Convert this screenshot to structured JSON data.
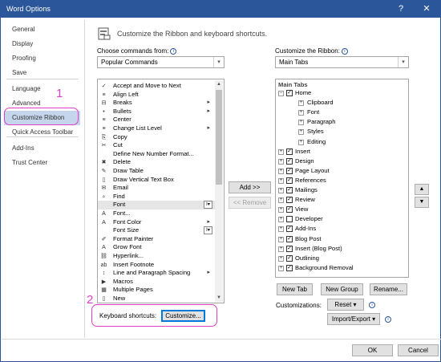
{
  "window": {
    "title": "Word Options",
    "help": "?",
    "close": "✕"
  },
  "nav": {
    "items": [
      {
        "label": "General"
      },
      {
        "label": "Display"
      },
      {
        "label": "Proofing"
      },
      {
        "label": "Save"
      },
      {
        "label": "Language"
      },
      {
        "label": "Advanced"
      },
      {
        "label": "Customize Ribbon"
      },
      {
        "label": "Quick Access Toolbar"
      },
      {
        "label": "Add-Ins"
      },
      {
        "label": "Trust Center"
      }
    ]
  },
  "header": {
    "text": "Customize the Ribbon and keyboard shortcuts."
  },
  "commands": {
    "label": "Choose commands from:",
    "selected": "Popular Commands",
    "items": [
      {
        "label": "Accept and Move to Next",
        "icon": "✓"
      },
      {
        "label": "Align Left",
        "icon": "≡"
      },
      {
        "label": "Breaks",
        "icon": "⊟",
        "sub": "▸"
      },
      {
        "label": "Bullets",
        "icon": "•",
        "sub": "▸"
      },
      {
        "label": "Center",
        "icon": "≡"
      },
      {
        "label": "Change List Level",
        "icon": "≡",
        "sub": "▸"
      },
      {
        "label": "Copy",
        "icon": "⎘"
      },
      {
        "label": "Cut",
        "icon": "✂"
      },
      {
        "label": "Define New Number Format...",
        "icon": ""
      },
      {
        "label": "Delete",
        "icon": "✖"
      },
      {
        "label": "Draw Table",
        "icon": "✎"
      },
      {
        "label": "Draw Vertical Text Box",
        "icon": "▯"
      },
      {
        "label": "Email",
        "icon": "✉"
      },
      {
        "label": "Find",
        "icon": "⌕"
      },
      {
        "label": "Font",
        "icon": "",
        "fbox": "I▾"
      },
      {
        "label": "Font...",
        "icon": "A"
      },
      {
        "label": "Font Color",
        "icon": "A",
        "sub": "▸"
      },
      {
        "label": "Font Size",
        "icon": "",
        "fbox": "I▾"
      },
      {
        "label": "Format Painter",
        "icon": "✐"
      },
      {
        "label": "Grow Font",
        "icon": "A"
      },
      {
        "label": "Hyperlink...",
        "icon": "⛓"
      },
      {
        "label": "Insert Footnote",
        "icon": "ab"
      },
      {
        "label": "Line and Paragraph Spacing",
        "icon": "↕",
        "sub": "▸"
      },
      {
        "label": "Macros",
        "icon": "▶"
      },
      {
        "label": "Multiple Pages",
        "icon": "▦"
      },
      {
        "label": "New",
        "icon": "▯"
      }
    ]
  },
  "middle": {
    "add": "Add >>",
    "remove": "<< Remove"
  },
  "ribbon": {
    "label": "Customize the Ribbon:",
    "selected": "Main Tabs",
    "header": "Main Tabs",
    "tree": [
      {
        "label": "Home",
        "level": 0,
        "exp": "−",
        "checked": true
      },
      {
        "label": "Clipboard",
        "level": 1,
        "exp": "+",
        "checked": null
      },
      {
        "label": "Font",
        "level": 1,
        "exp": "+",
        "checked": null
      },
      {
        "label": "Paragraph",
        "level": 1,
        "exp": "+",
        "checked": null
      },
      {
        "label": "Styles",
        "level": 1,
        "exp": "+",
        "checked": null
      },
      {
        "label": "Editing",
        "level": 1,
        "exp": "+",
        "checked": null
      },
      {
        "label": "Insert",
        "level": 0,
        "exp": "+",
        "checked": true
      },
      {
        "label": "Design",
        "level": 0,
        "exp": "+",
        "checked": true
      },
      {
        "label": "Page Layout",
        "level": 0,
        "exp": "+",
        "checked": true
      },
      {
        "label": "References",
        "level": 0,
        "exp": "+",
        "checked": true
      },
      {
        "label": "Mailings",
        "level": 0,
        "exp": "+",
        "checked": true
      },
      {
        "label": "Review",
        "level": 0,
        "exp": "+",
        "checked": true
      },
      {
        "label": "View",
        "level": 0,
        "exp": "+",
        "checked": true
      },
      {
        "label": "Developer",
        "level": 0,
        "exp": "+",
        "checked": false
      },
      {
        "label": "Add-Ins",
        "level": 0,
        "exp": "+",
        "checked": true
      },
      {
        "label": "Blog Post",
        "level": 0,
        "exp": "+",
        "checked": true
      },
      {
        "label": "Insert (Blog Post)",
        "level": 0,
        "exp": "+",
        "checked": true
      },
      {
        "label": "Outlining",
        "level": 0,
        "exp": "+",
        "checked": true
      },
      {
        "label": "Background Removal",
        "level": 0,
        "exp": "+",
        "checked": true
      }
    ],
    "new_tab": "New Tab",
    "new_group": "New Group",
    "rename": "Rename...",
    "customizations_label": "Customizations:",
    "reset": "Reset ▾",
    "import_export": "Import/Export ▾"
  },
  "keyboard": {
    "label": "Keyboard shortcuts:",
    "button": "Customize..."
  },
  "footer": {
    "ok": "OK",
    "cancel": "Cancel"
  },
  "annotations": {
    "one": "1",
    "two": "2"
  },
  "colors": {
    "titlebar": "#2b579a",
    "nav_selected": "#c5d6ec",
    "annotation": "#e040c8"
  }
}
